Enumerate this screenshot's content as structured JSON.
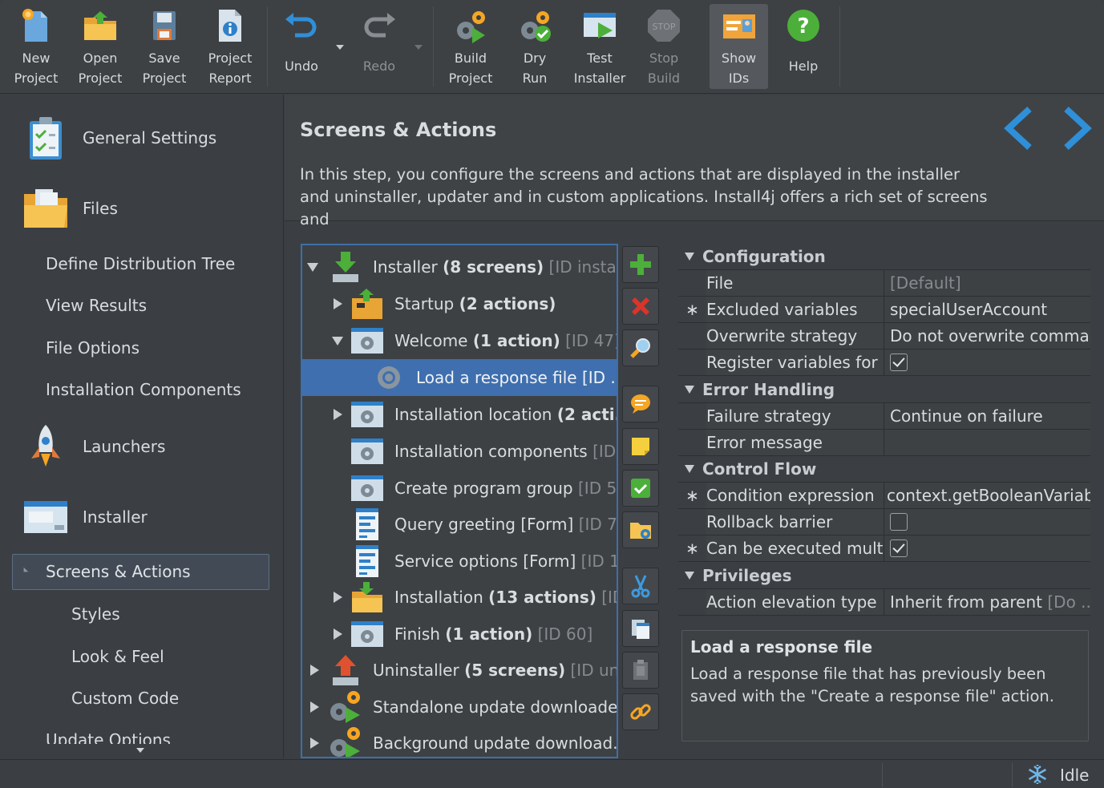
{
  "toolbar": {
    "buttons": [
      {
        "line1": "New",
        "line2": "Project",
        "icon": "new-project-icon"
      },
      {
        "line1": "Open",
        "line2": "Project",
        "icon": "open-folder-icon"
      },
      {
        "line1": "Save",
        "line2": "Project",
        "icon": "save-disk-icon"
      },
      {
        "line1": "Project",
        "line2": "Report",
        "icon": "report-icon"
      },
      {
        "line1": "Undo",
        "icon": "undo-arrow-icon"
      },
      {
        "line1": "Redo",
        "icon": "redo-arrow-icon"
      },
      {
        "line1": "Build",
        "line2": "Project",
        "icon": "build-gears-icon"
      },
      {
        "line1": "Dry",
        "line2": "Run",
        "icon": "dry-run-icon"
      },
      {
        "line1": "Test",
        "line2": "Installer",
        "icon": "test-installer-icon"
      },
      {
        "line1": "Stop",
        "line2": "Build",
        "icon": "stop-sign-icon"
      },
      {
        "line1": "Show",
        "line2": "IDs",
        "icon": "show-ids-icon"
      },
      {
        "line1": "Help",
        "icon": "help-icon"
      }
    ]
  },
  "sidebar": {
    "general_settings": "General Settings",
    "files": "Files",
    "define_distribution_tree": "Define Distribution Tree",
    "view_results": "View Results",
    "file_options": "File Options",
    "installation_components": "Installation Components",
    "launchers": "Launchers",
    "installer": "Installer",
    "screens_actions": "Screens & Actions",
    "styles": "Styles",
    "look_feel": "Look & Feel",
    "custom_code": "Custom Code",
    "update_options": "Update Options"
  },
  "header": {
    "title": "Screens & Actions",
    "description": "In this step, you configure the screens and actions that are displayed in the installer and uninstaller, updater and in custom applications. Install4j offers a rich set of screens and"
  },
  "tree": {
    "rows": [
      {
        "name": "Installer",
        "bold": "(8 screens)",
        "id": "[ID install..."
      },
      {
        "name": "Startup",
        "bold": "(2 actions)",
        "id": ""
      },
      {
        "name": "Welcome",
        "bold": "(1 action)",
        "id": "[ID 47]"
      },
      {
        "name": "Load a response file [ID ...",
        "bold": "",
        "id": ""
      },
      {
        "name": "Installation location",
        "bold": "(2 acti...",
        "id": ""
      },
      {
        "name": "Installation components",
        "bold": "",
        "id": "[ID..."
      },
      {
        "name": "Create program group",
        "bold": "",
        "id": "[ID 5..."
      },
      {
        "name": "Query greeting [Form]",
        "bold": "",
        "id": "[ID 73]"
      },
      {
        "name": "Service options [Form]",
        "bold": "",
        "id": "[ID 1..."
      },
      {
        "name": "Installation",
        "bold": "(13 actions)",
        "id": "[ID..."
      },
      {
        "name": "Finish",
        "bold": "(1 action)",
        "id": "[ID 60]"
      },
      {
        "name": "Uninstaller",
        "bold": "(5 screens)",
        "id": "[ID uni..."
      },
      {
        "name": "Standalone update downloade...",
        "bold": "",
        "id": ""
      },
      {
        "name": "Background update download...",
        "bold": "",
        "id": ""
      }
    ]
  },
  "properties": {
    "configuration": "Configuration",
    "file_key": "File",
    "file_val": "[Default]",
    "excluded_key": "Excluded variables",
    "excluded_val": "specialUserAccount",
    "overwrite_key": "Overwrite strategy",
    "overwrite_val": "Do not overwrite comma...",
    "register_key": "Register variables for ...",
    "error_handling": "Error Handling",
    "failure_key": "Failure strategy",
    "failure_val": "Continue on failure",
    "errmsg_key": "Error message",
    "control_flow": "Control Flow",
    "condition_key": "Condition expression",
    "condition_val": "context.getBooleanVariable",
    "rollback_key": "Rollback barrier",
    "multiple_key": "Can be executed mult...",
    "privileges": "Privileges",
    "elevation_key": "Action elevation type",
    "elevation_val": "Inherit from parent",
    "elevation_ph": "[Do ...",
    "star": "∗"
  },
  "help": {
    "title": "Load a response file",
    "text": "Load a response file that has previously been saved with the \"Create a response file\" action."
  },
  "status": {
    "state": "Idle"
  },
  "colors": {
    "accent": "#3f6fae",
    "nav_arrow": "#2f8fd8",
    "green": "#4caf3a",
    "red": "#d9352a"
  }
}
